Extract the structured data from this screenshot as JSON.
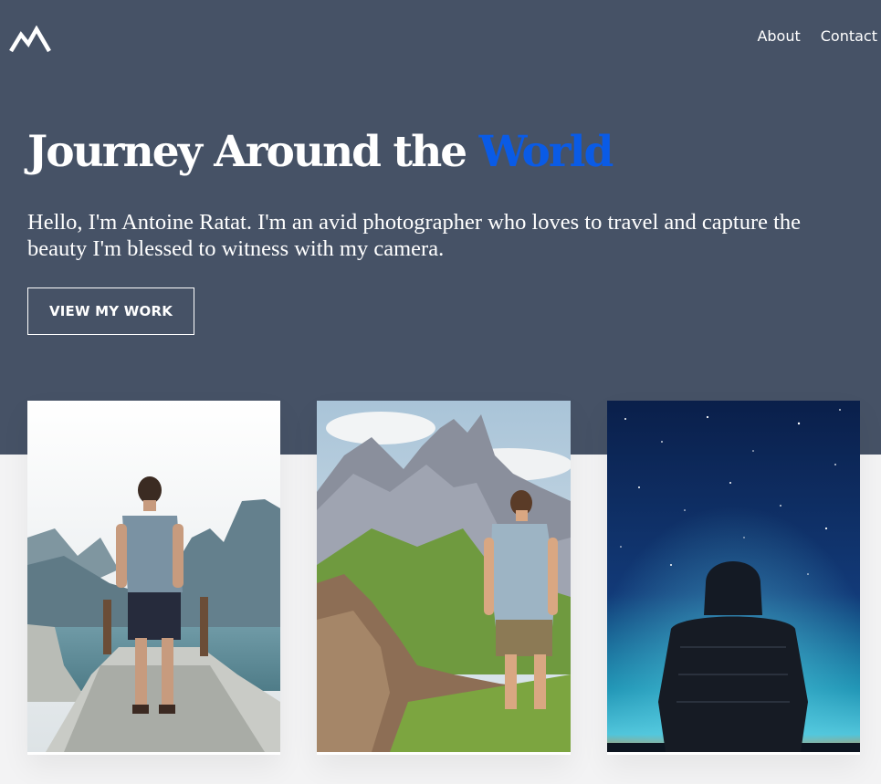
{
  "nav": {
    "logo_icon": "mountain-logo-icon",
    "items": [
      {
        "label": "About"
      },
      {
        "label": "Contact"
      }
    ]
  },
  "hero": {
    "title_main": "Journey Around the ",
    "title_accent": "World",
    "accent_color": "#0a5be6",
    "background_color": "#465266",
    "intro": "Hello, I'm Antoine Ratat. I'm an avid photographer who loves to travel and capture the beauty I'm blessed to witness with my camera.",
    "cta_label": "VIEW MY WORK"
  },
  "gallery": {
    "photos": [
      {
        "icon": "lake-pier-photo-icon"
      },
      {
        "icon": "mountain-ridge-photo-icon"
      },
      {
        "icon": "night-sky-photo-icon"
      }
    ]
  }
}
